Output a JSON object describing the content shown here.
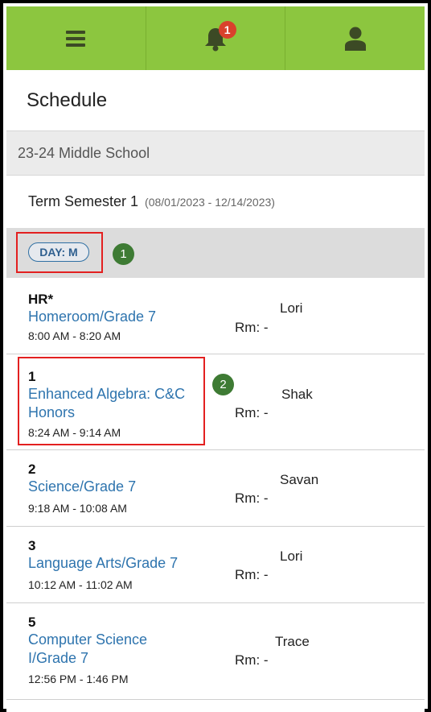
{
  "nav": {
    "notification_count": "1",
    "colors": {
      "bar": "#8cc63f",
      "badge": "#d9412c"
    }
  },
  "page_title": "Schedule",
  "school_year": "23-24 Middle School",
  "term": {
    "name": "Term Semester 1",
    "dates": "(08/01/2023 - 12/14/2023)"
  },
  "day_label": "DAY: M",
  "callouts": [
    "1",
    "2"
  ],
  "periods": [
    {
      "period": "HR*",
      "course": "Homeroom/Grade 7",
      "time": "8:00 AM - 8:20 AM",
      "room": "Rm: -",
      "teacher": "Lori"
    },
    {
      "period": "1",
      "course": "Enhanced Algebra: C&C Honors",
      "time": "8:24 AM - 9:14 AM",
      "room": "Rm: -",
      "teacher": "Shak"
    },
    {
      "period": "2",
      "course": "Science/Grade 7",
      "time": "9:18 AM - 10:08 AM",
      "room": "Rm: -",
      "teacher": "Savan"
    },
    {
      "period": "3",
      "course": "Language Arts/Grade 7",
      "time": "10:12 AM - 11:02 AM",
      "room": "Rm: -",
      "teacher": "Lori"
    },
    {
      "period": "5",
      "course": "Computer Science I/Grade 7",
      "time": "12:56 PM - 1:46 PM",
      "room": "Rm: -",
      "teacher": "Trace"
    }
  ]
}
